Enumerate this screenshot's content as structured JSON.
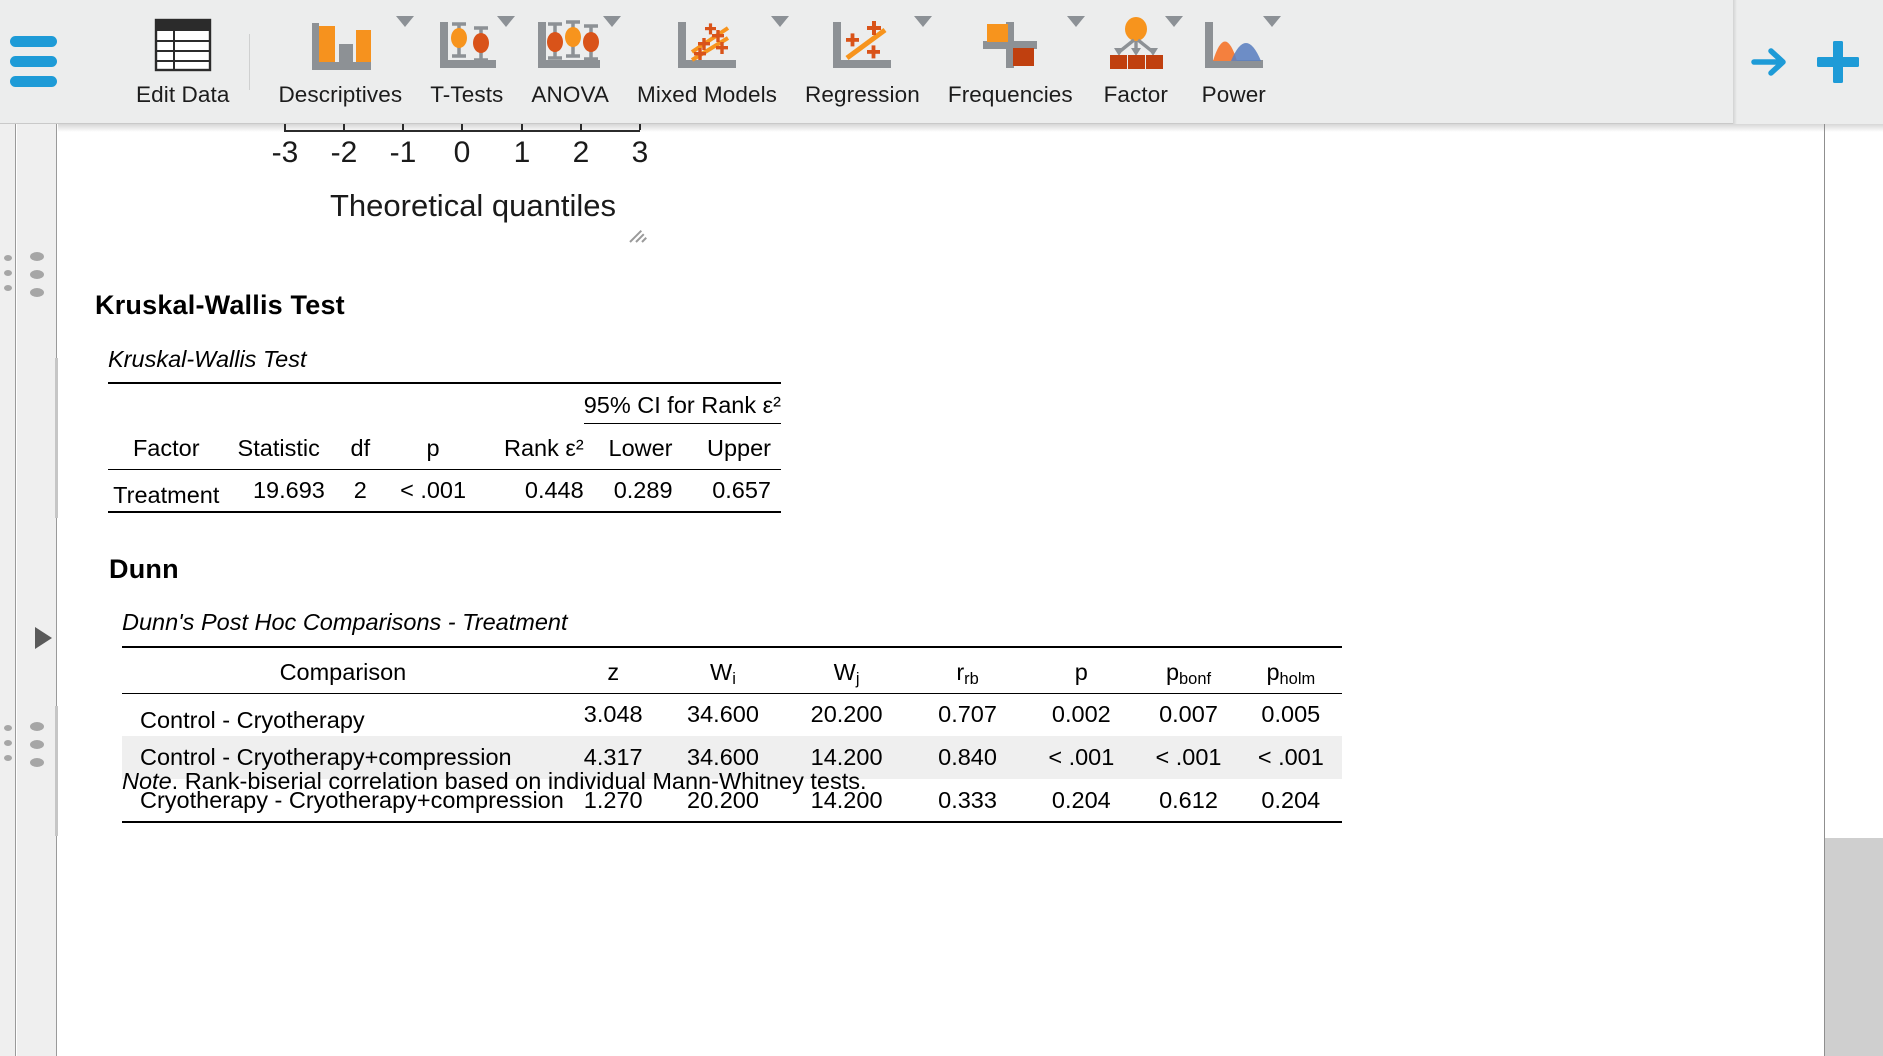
{
  "ribbon": {
    "menu_icon": "hamburger-icon",
    "items": [
      {
        "label": "Edit Data",
        "icon": "spreadsheet-icon",
        "caret": false
      },
      {
        "label": "Descriptives",
        "icon": "bar-chart-icon",
        "caret": true
      },
      {
        "label": "T-Tests",
        "icon": "errorbar-icon",
        "caret": true
      },
      {
        "label": "ANOVA",
        "icon": "anova-icon",
        "caret": true
      },
      {
        "label": "Mixed Models",
        "icon": "mixed-models-icon",
        "caret": true
      },
      {
        "label": "Regression",
        "icon": "scatter-line-icon",
        "caret": true
      },
      {
        "label": "Frequencies",
        "icon": "crosstab-icon",
        "caret": true
      },
      {
        "label": "Factor",
        "icon": "factor-tree-icon",
        "caret": true
      },
      {
        "label": "Power",
        "icon": "power-curve-icon",
        "caret": true
      }
    ],
    "modules_icon": "arrow-right-icon",
    "add_icon": "plus-icon",
    "accent_color": "#1e9bd7"
  },
  "plot": {
    "axis_title": "Theoretical quantiles",
    "tick_labels": [
      "-3",
      "-2",
      "-1",
      "0",
      "1",
      "2",
      "3"
    ],
    "resize_handle": "resize-grip-icon"
  },
  "kruskal": {
    "heading": "Kruskal-Wallis Test",
    "caption": "Kruskal-Wallis Test",
    "span_header": "95% CI for Rank ε²",
    "columns": [
      "Factor",
      "Statistic",
      "df",
      "p",
      "Rank ε²",
      "Lower",
      "Upper"
    ],
    "rows": [
      [
        "Treatment",
        "19.693",
        "2",
        "< .001",
        "0.448",
        "0.289",
        "0.657"
      ]
    ]
  },
  "dunn": {
    "heading": "Dunn",
    "caption": "Dunn's Post Hoc Comparisons - Treatment",
    "columns": [
      {
        "label": "Comparison",
        "sub": ""
      },
      {
        "label": "z",
        "sub": ""
      },
      {
        "label": "W",
        "sub": "i"
      },
      {
        "label": "W",
        "sub": "j"
      },
      {
        "label": "r",
        "sub": "rb"
      },
      {
        "label": "p",
        "sub": ""
      },
      {
        "label": "p",
        "sub": "bonf"
      },
      {
        "label": "p",
        "sub": "holm"
      }
    ],
    "rows": [
      [
        "Control - Cryotherapy",
        "3.048",
        "34.600",
        "20.200",
        "0.707",
        "0.002",
        "0.007",
        "0.005"
      ],
      [
        "Control - Cryotherapy+compression",
        "4.317",
        "34.600",
        "14.200",
        "0.840",
        "< .001",
        "< .001",
        "< .001"
      ],
      [
        "Cryotherapy - Cryotherapy+compression",
        "1.270",
        "20.200",
        "14.200",
        "0.333",
        "0.204",
        "0.612",
        "0.204"
      ]
    ],
    "note_prefix": "Note",
    "note_text": ". Rank-biserial correlation based on individual Mann-Whitney tests."
  }
}
